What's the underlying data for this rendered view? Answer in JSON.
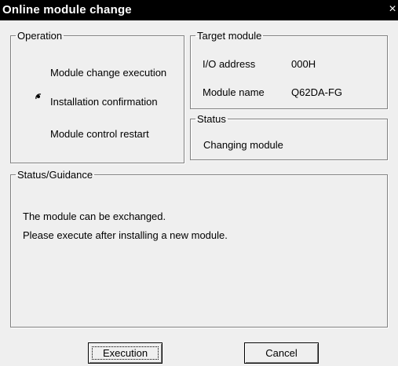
{
  "window": {
    "title": "Online module change",
    "close_glyph": "×"
  },
  "operation": {
    "legend": "Operation",
    "options": [
      {
        "label": "Module change execution",
        "selected": false
      },
      {
        "label": "Installation confirmation",
        "selected": true
      },
      {
        "label": "Module control restart",
        "selected": false
      }
    ]
  },
  "target_module": {
    "legend": "Target module",
    "io_address_label": "I/O address",
    "io_address_value": "000H",
    "module_name_label": "Module name",
    "module_name_value": "Q62DA-FG"
  },
  "status": {
    "legend": "Status",
    "text": "Changing module"
  },
  "guidance": {
    "legend": "Status/Guidance",
    "lines": [
      "The module can be exchanged.",
      "Please execute after installing a new module."
    ]
  },
  "buttons": {
    "execution": "Execution",
    "cancel": "Cancel"
  }
}
